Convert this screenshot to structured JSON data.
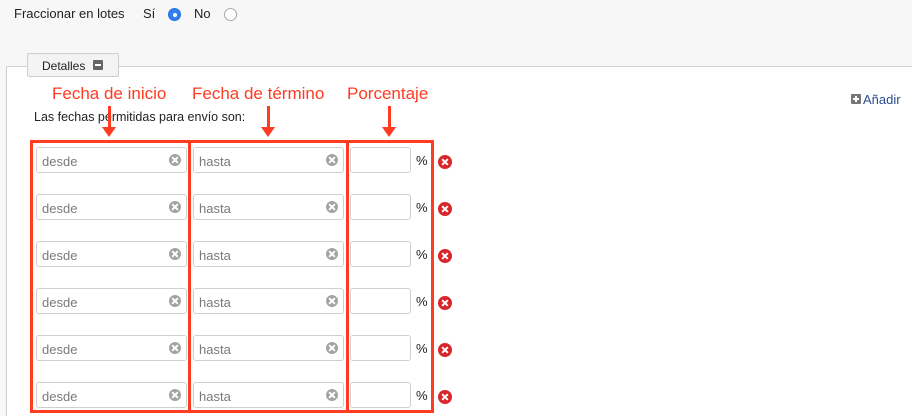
{
  "lot": {
    "label": "Fraccionar en lotes",
    "options": [
      {
        "label": "Sí",
        "selected": true
      },
      {
        "label": "No",
        "selected": false
      }
    ]
  },
  "panel": {
    "tab_label": "Detalles",
    "add_label": "Añadir",
    "dates_label": "Las fechas permitidas para envío son:"
  },
  "annotations": [
    "Fecha de inicio",
    "Fecha de término",
    "Porcentaje"
  ],
  "annotation_color": "#ff3b22",
  "rows": [
    {
      "desde_placeholder": "desde",
      "hasta_placeholder": "hasta",
      "percent_sign": "%"
    },
    {
      "desde_placeholder": "desde",
      "hasta_placeholder": "hasta",
      "percent_sign": "%"
    },
    {
      "desde_placeholder": "desde",
      "hasta_placeholder": "hasta",
      "percent_sign": "%"
    },
    {
      "desde_placeholder": "desde",
      "hasta_placeholder": "hasta",
      "percent_sign": "%"
    },
    {
      "desde_placeholder": "desde",
      "hasta_placeholder": "hasta",
      "percent_sign": "%"
    },
    {
      "desde_placeholder": "desde",
      "hasta_placeholder": "hasta",
      "percent_sign": "%"
    }
  ]
}
